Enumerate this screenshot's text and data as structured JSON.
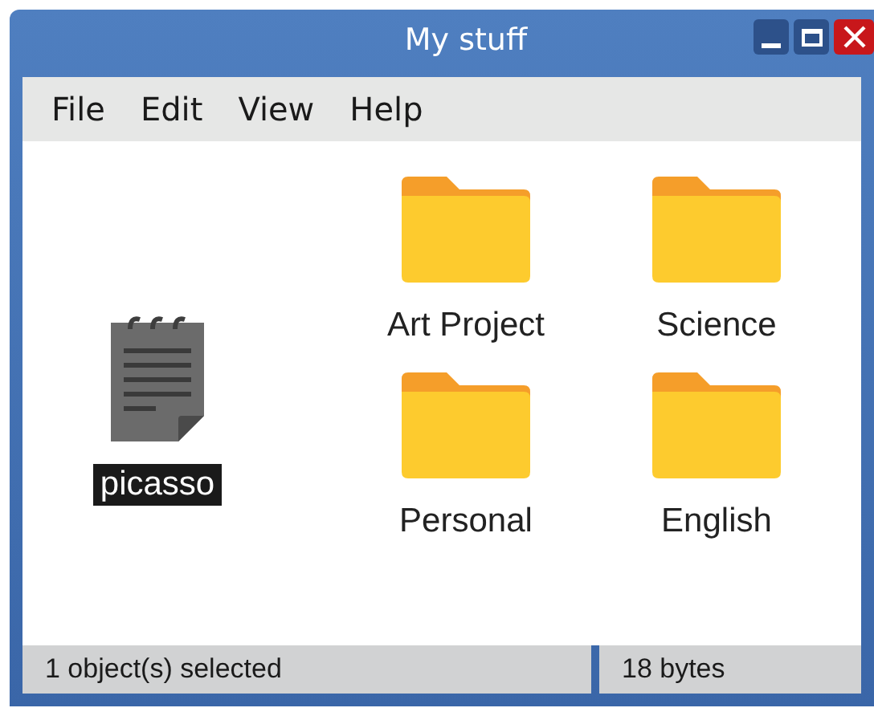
{
  "window": {
    "title": "My stuff"
  },
  "menu": [
    "File",
    "Edit",
    "View",
    "Help"
  ],
  "items": [
    {
      "kind": "file",
      "label": "picasso",
      "selected": true
    },
    {
      "kind": "folder",
      "label": "Art Project",
      "selected": false
    },
    {
      "kind": "folder",
      "label": "Science",
      "selected": false
    },
    {
      "kind": "folder",
      "label": "Personal",
      "selected": false
    },
    {
      "kind": "folder",
      "label": "English",
      "selected": false
    }
  ],
  "status_bar": [
    "1 object(s) selected",
    "18 bytes"
  ]
}
